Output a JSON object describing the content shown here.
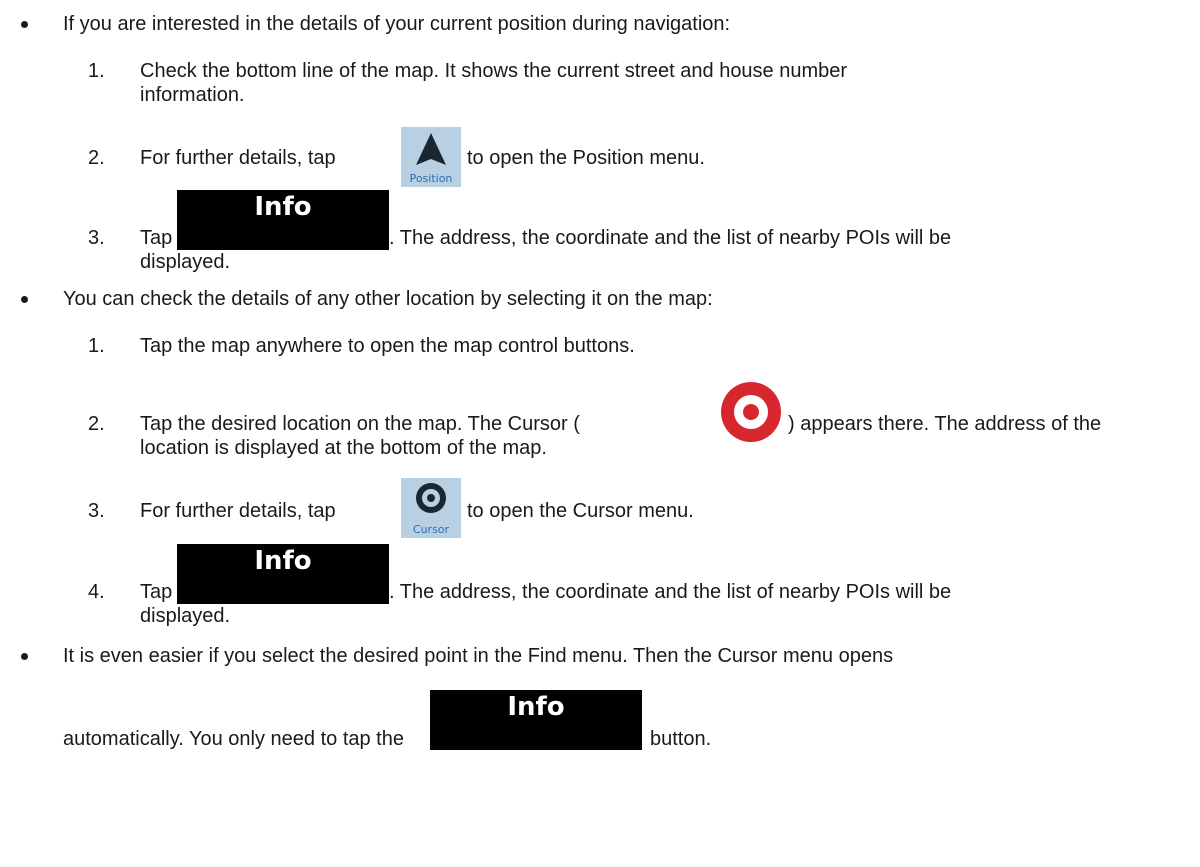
{
  "section1": {
    "intro": "If you are interested in the details of your current position during navigation:",
    "steps": [
      {
        "num": "1.",
        "line1": "Check the bottom line of the map. It shows the current street and house number",
        "line2": "information."
      },
      {
        "num": "2.",
        "before": "For further details, tap",
        "after": "to open the Position menu.",
        "icon_label": "Position",
        "icon": "position-arrow-icon"
      },
      {
        "num": "3.",
        "before": "Tap",
        "after": ". The address, the coordinate and the list of nearby POIs will be",
        "line2": "displayed.",
        "button_label": "Info"
      }
    ]
  },
  "section2": {
    "intro": "You can check the details of any other location by selecting it on the map:",
    "steps": [
      {
        "num": "1.",
        "text": "Tap the map anywhere to open the map control buttons."
      },
      {
        "num": "2.",
        "before": "Tap the desired location on the map. The Cursor (",
        "after": ") appears there. The address of the",
        "line2": "location is displayed at the bottom of the map.",
        "icon": "cursor-target-icon"
      },
      {
        "num": "3.",
        "before": "For further details, tap",
        "after": "to open the Cursor menu.",
        "icon_label": "Cursor",
        "icon": "cursor-button-icon"
      },
      {
        "num": "4.",
        "before": "Tap",
        "after": ". The address, the coordinate and the list of nearby POIs will be",
        "line2": "displayed.",
        "button_label": "Info"
      }
    ]
  },
  "section3": {
    "line1": "It is even easier if you select the desired point in the Find menu. Then the Cursor menu opens",
    "before": "automatically. You only need to tap the",
    "after": "button.",
    "button_label": "Info"
  },
  "colors": {
    "text": "#1a1a1a",
    "tile_bg": "#b9d0e2",
    "tile_label": "#2a6fb0",
    "cursor_red": "#d7262e",
    "button_bg": "#000000"
  }
}
